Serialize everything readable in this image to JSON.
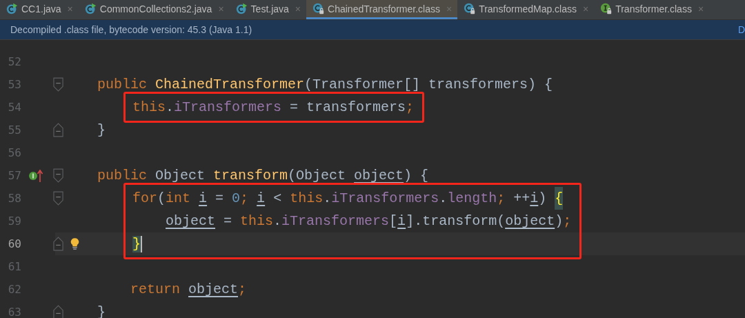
{
  "tabs": [
    {
      "label": "CC1.java",
      "kind": "class-run",
      "close": "×",
      "selected": false
    },
    {
      "label": "CommonCollections2.java",
      "kind": "class-run",
      "close": "×",
      "selected": false
    },
    {
      "label": "Test.java",
      "kind": "class-run",
      "close": "×",
      "selected": false
    },
    {
      "label": "ChainedTransformer.class",
      "kind": "class-locked",
      "close": "×",
      "selected": true
    },
    {
      "label": "TransformedMap.class",
      "kind": "class-locked",
      "close": "×",
      "selected": false
    },
    {
      "label": "Transformer.class",
      "kind": "interface-locked",
      "close": "×",
      "selected": false
    }
  ],
  "banner": {
    "text": "Decompiled .class file, bytecode version: 45.3 (Java 1.1)",
    "link": "D"
  },
  "lines": [
    {
      "number": "52",
      "kind": "plain",
      "current": false
    },
    {
      "number": "53",
      "kind": "fold-start",
      "current": false,
      "boxed": false,
      "tokens": [
        {
          "kind": "keyword",
          "text": "public "
        },
        {
          "kind": "method",
          "text": "ChainedTransformer"
        },
        {
          "kind": "plain",
          "text": "(Transformer[] transformers) {"
        }
      ],
      "children": [
        {
          "number": "54",
          "kind": "plain",
          "current": false,
          "boxed": true,
          "tokens": [
            {
              "kind": "keyword",
              "text": "this"
            },
            {
              "kind": "plain",
              "text": "."
            },
            {
              "kind": "field",
              "text": "iTransformers"
            },
            {
              "kind": "plain",
              "text": " = transformers"
            },
            {
              "kind": "keyword",
              "text": ";"
            }
          ]
        }
      ]
    },
    {
      "number": "55",
      "kind": "fold-end",
      "current": false,
      "boxed": false,
      "tokens": [
        {
          "kind": "plain",
          "text": "}"
        }
      ]
    },
    {
      "number": "56",
      "kind": "plain",
      "current": false
    },
    {
      "number": "57",
      "kind": "fold-start-implements",
      "current": false,
      "boxed": false,
      "tokens": [
        {
          "kind": "keyword",
          "text": "public "
        },
        {
          "kind": "plain",
          "text": "Object "
        },
        {
          "kind": "method",
          "text": "transform"
        },
        {
          "kind": "plain",
          "text": "(Object "
        },
        {
          "kind": "reassigned",
          "text": "object"
        },
        {
          "kind": "plain",
          "text": ") {"
        }
      ],
      "children": [
        {
          "number": "58",
          "kind": "fold-start",
          "current": false,
          "boxed": true,
          "tokens": [
            {
              "kind": "keyword",
              "text": "for"
            },
            {
              "kind": "plain",
              "text": "("
            },
            {
              "kind": "keyword",
              "text": "int "
            },
            {
              "kind": "reassigned",
              "text": "i"
            },
            {
              "kind": "plain",
              "text": " = "
            },
            {
              "kind": "number",
              "text": "0"
            },
            {
              "kind": "keyword",
              "text": "; "
            },
            {
              "kind": "reassigned",
              "text": "i"
            },
            {
              "kind": "plain",
              "text": " < "
            },
            {
              "kind": "keyword",
              "text": "this"
            },
            {
              "kind": "plain",
              "text": "."
            },
            {
              "kind": "field",
              "text": "iTransformers"
            },
            {
              "kind": "plain",
              "text": "."
            },
            {
              "kind": "field",
              "text": "length"
            },
            {
              "kind": "keyword",
              "text": "; "
            },
            {
              "kind": "plain",
              "text": "++"
            },
            {
              "kind": "reassigned",
              "text": "i"
            },
            {
              "kind": "plain",
              "text": ") "
            },
            {
              "kind": "brace-match",
              "text": "{"
            }
          ],
          "children": [
            {
              "number": "59",
              "current": false,
              "boxed": true,
              "tokens": [
                {
                  "kind": "reassigned",
                  "text": "object"
                },
                {
                  "kind": "plain",
                  "text": " = "
                },
                {
                  "kind": "keyword",
                  "text": "this"
                },
                {
                  "kind": "plain",
                  "text": "."
                },
                {
                  "kind": "field",
                  "text": "iTransformers"
                },
                {
                  "kind": "plain",
                  "text": "["
                },
                {
                  "kind": "reassigned",
                  "text": "i"
                },
                {
                  "kind": "plain",
                  "text": "].transform("
                },
                {
                  "kind": "reassigned",
                  "text": "object"
                },
                {
                  "kind": "plain",
                  "text": ")"
                },
                {
                  "kind": "keyword",
                  "text": ";"
                }
              ]
            }
          ]
        },
        {
          "number": "60",
          "kind": "fold-end-bulb",
          "current": true,
          "boxed": true,
          "tokens": [
            {
              "kind": "brace-match",
              "text": "}"
            }
          ]
        },
        {
          "number": "61",
          "kind": "plain",
          "current": false
        },
        {
          "number": "62",
          "kind": "plain",
          "current": false,
          "boxed": false,
          "tokens": [
            {
              "kind": "keyword",
              "text": "return "
            },
            {
              "kind": "reassigned",
              "text": "object"
            },
            {
              "kind": "keyword",
              "text": ";"
            }
          ]
        }
      ]
    },
    {
      "number": "63",
      "kind": "fold-end",
      "current": false,
      "boxed": false,
      "tokens": [
        {
          "kind": "plain",
          "text": "}"
        }
      ]
    }
  ]
}
